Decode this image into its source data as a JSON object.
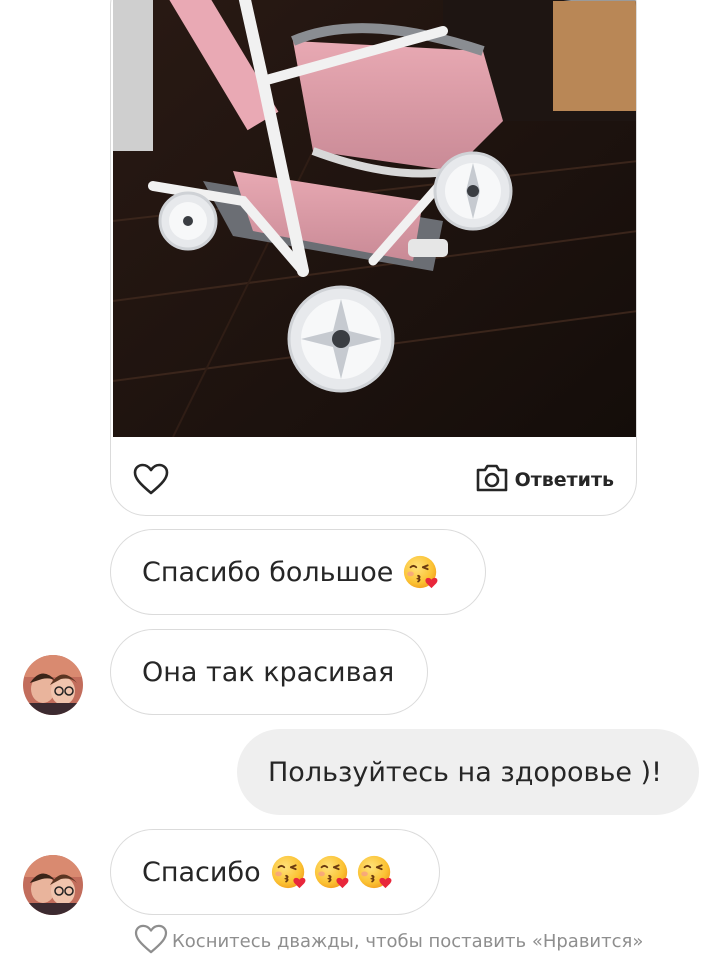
{
  "photo_card": {
    "reply_label": "Ответить",
    "icons": {
      "like": "heart-outline-icon",
      "reply": "camera-icon"
    }
  },
  "messages": [
    {
      "direction": "incoming",
      "text": "Спасибо большое",
      "emoji": [
        "face-blowing-a-kiss"
      ],
      "avatar": false
    },
    {
      "direction": "incoming",
      "text": "Она так красивая",
      "emoji": [],
      "avatar": true
    },
    {
      "direction": "outgoing",
      "text": "Пользуйтесь на здоровье )!",
      "emoji": [],
      "avatar": false
    },
    {
      "direction": "incoming",
      "text": "Спасибо",
      "emoji": [
        "face-blowing-a-kiss",
        "face-blowing-a-kiss",
        "face-blowing-a-kiss"
      ],
      "avatar": true
    }
  ],
  "hint": {
    "text": "Коснитесь дважды, чтобы поставить «Нравится»",
    "icon": "heart-outline-icon"
  },
  "colors": {
    "bubble_border": "#dbdbdb",
    "outgoing_bubble": "#efefef",
    "text": "#262626",
    "hint_text": "#8e8e8e"
  }
}
